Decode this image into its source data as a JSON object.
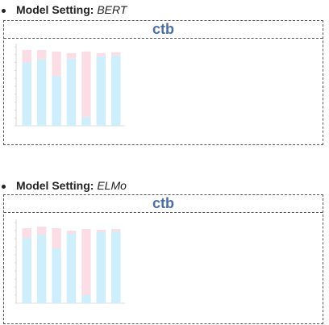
{
  "sections": [
    {
      "label_prefix": "Model Setting:",
      "model": "BERT",
      "panel_title": "ctb",
      "chart_data": {
        "type": "bar",
        "stacked": true,
        "ylim": [
          0,
          100
        ],
        "categories": [
          "",
          "",
          "",
          "",
          "",
          "",
          ""
        ],
        "series": [
          {
            "color": "#cdeefa",
            "values": [
              80,
              84,
              63,
              85,
              11,
              88,
              89
            ]
          },
          {
            "color": "#fbdde6",
            "values": [
              16,
              12,
              31,
              7,
              83,
              4,
              4
            ]
          }
        ]
      }
    },
    {
      "label_prefix": "Model Setting:",
      "model": "ELMo",
      "panel_title": "ctb",
      "chart_data": {
        "type": "bar",
        "stacked": true,
        "ylim": [
          0,
          100
        ],
        "categories": [
          "",
          "",
          "",
          "",
          "",
          "",
          ""
        ],
        "series": [
          {
            "color": "#cdeefa",
            "values": [
              81,
              85,
              68,
              86,
              10,
              88,
              89
            ]
          },
          {
            "color": "#fbdde6",
            "values": [
              12,
              10,
              25,
              4,
              82,
              3,
              3
            ]
          }
        ]
      }
    }
  ]
}
